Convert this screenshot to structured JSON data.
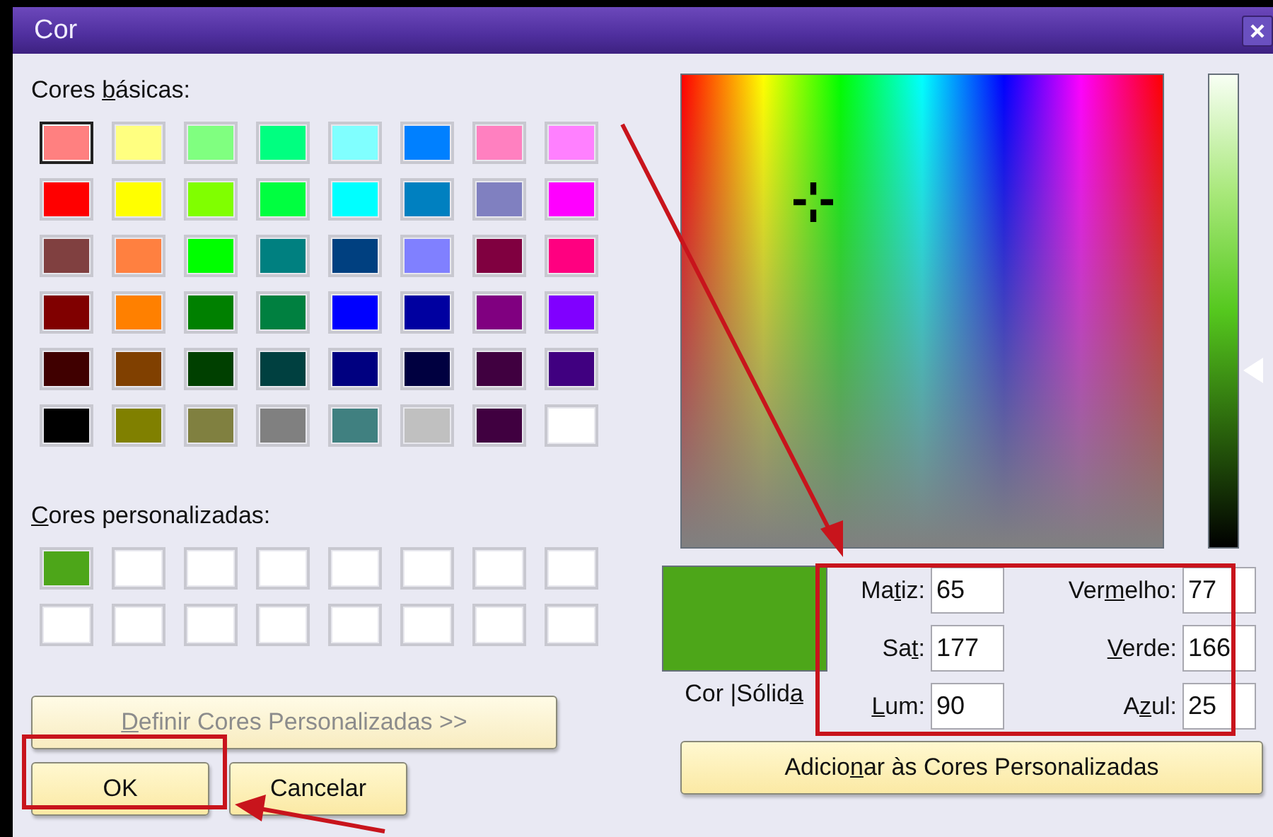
{
  "window": {
    "title": "Cor"
  },
  "basic_colors": {
    "label": {
      "before": "Cores ",
      "key": "b",
      "after": "ásicas:"
    },
    "swatches": [
      {
        "color": "#ff8080",
        "selected": true
      },
      {
        "color": "#ffff80",
        "selected": false
      },
      {
        "color": "#80ff80",
        "selected": false
      },
      {
        "color": "#00ff80",
        "selected": false
      },
      {
        "color": "#80ffff",
        "selected": false
      },
      {
        "color": "#0080ff",
        "selected": false
      },
      {
        "color": "#ff80c0",
        "selected": false
      },
      {
        "color": "#ff80ff",
        "selected": false
      },
      {
        "color": "#ff0000",
        "selected": false
      },
      {
        "color": "#ffff00",
        "selected": false
      },
      {
        "color": "#80ff00",
        "selected": false
      },
      {
        "color": "#00ff40",
        "selected": false
      },
      {
        "color": "#00ffff",
        "selected": false
      },
      {
        "color": "#0080c0",
        "selected": false
      },
      {
        "color": "#8080c0",
        "selected": false
      },
      {
        "color": "#ff00ff",
        "selected": false
      },
      {
        "color": "#804040",
        "selected": false
      },
      {
        "color": "#ff8040",
        "selected": false
      },
      {
        "color": "#00ff00",
        "selected": false
      },
      {
        "color": "#008080",
        "selected": false
      },
      {
        "color": "#004080",
        "selected": false
      },
      {
        "color": "#8080ff",
        "selected": false
      },
      {
        "color": "#800040",
        "selected": false
      },
      {
        "color": "#ff0080",
        "selected": false
      },
      {
        "color": "#800000",
        "selected": false
      },
      {
        "color": "#ff8000",
        "selected": false
      },
      {
        "color": "#008000",
        "selected": false
      },
      {
        "color": "#008040",
        "selected": false
      },
      {
        "color": "#0000ff",
        "selected": false
      },
      {
        "color": "#0000a0",
        "selected": false
      },
      {
        "color": "#800080",
        "selected": false
      },
      {
        "color": "#8000ff",
        "selected": false
      },
      {
        "color": "#400000",
        "selected": false
      },
      {
        "color": "#804000",
        "selected": false
      },
      {
        "color": "#004000",
        "selected": false
      },
      {
        "color": "#004040",
        "selected": false
      },
      {
        "color": "#000080",
        "selected": false
      },
      {
        "color": "#000040",
        "selected": false
      },
      {
        "color": "#400040",
        "selected": false
      },
      {
        "color": "#400080",
        "selected": false
      },
      {
        "color": "#000000",
        "selected": false
      },
      {
        "color": "#808000",
        "selected": false
      },
      {
        "color": "#808040",
        "selected": false
      },
      {
        "color": "#808080",
        "selected": false
      },
      {
        "color": "#408080",
        "selected": false
      },
      {
        "color": "#c0c0c0",
        "selected": false
      },
      {
        "color": "#400040",
        "selected": false
      },
      {
        "color": "#ffffff",
        "selected": false
      }
    ]
  },
  "custom_colors": {
    "label": {
      "key": "C",
      "after": "ores personalizadas:"
    },
    "swatches": [
      {
        "color": "#4da619",
        "selected": false
      },
      {
        "color": "#ffffff",
        "selected": false
      },
      {
        "color": "#ffffff",
        "selected": false
      },
      {
        "color": "#ffffff",
        "selected": false
      },
      {
        "color": "#ffffff",
        "selected": false
      },
      {
        "color": "#ffffff",
        "selected": false
      },
      {
        "color": "#ffffff",
        "selected": false
      },
      {
        "color": "#ffffff",
        "selected": false
      },
      {
        "color": "#ffffff",
        "selected": false
      },
      {
        "color": "#ffffff",
        "selected": false
      },
      {
        "color": "#ffffff",
        "selected": false
      },
      {
        "color": "#ffffff",
        "selected": false
      },
      {
        "color": "#ffffff",
        "selected": false
      },
      {
        "color": "#ffffff",
        "selected": false
      },
      {
        "color": "#ffffff",
        "selected": false
      },
      {
        "color": "#ffffff",
        "selected": false
      }
    ]
  },
  "define_button": {
    "label": {
      "key": "D",
      "after": "efinir Cores Personalizadas >>"
    },
    "disabled": true
  },
  "ok_button": {
    "label": "OK"
  },
  "cancel_button": {
    "label": "Cancelar"
  },
  "luminance": {
    "level": 0.375
  },
  "preview": {
    "color": "#4da619",
    "label": {
      "before": "Cor |Sólid",
      "key": "a"
    }
  },
  "fields": [
    {
      "label": {
        "before": "Ma",
        "key": "t",
        "after": "iz:"
      },
      "value": "65"
    },
    {
      "label": {
        "before": "Ver",
        "key": "m",
        "after": "elho:"
      },
      "value": "77"
    },
    {
      "label": {
        "before": "Sa",
        "key": "t",
        "after": ":"
      },
      "value": "177"
    },
    {
      "label": {
        "key": "V",
        "after": "erde:"
      },
      "value": "166"
    },
    {
      "label": {
        "key": "L",
        "after": "um:"
      },
      "value": "90"
    },
    {
      "label": {
        "before": "A",
        "key": "z",
        "after": "ul:"
      },
      "value": "25"
    }
  ],
  "add_button": {
    "label": {
      "before": "Adicio",
      "key": "n",
      "after": "ar às Cores Personalizadas"
    }
  }
}
